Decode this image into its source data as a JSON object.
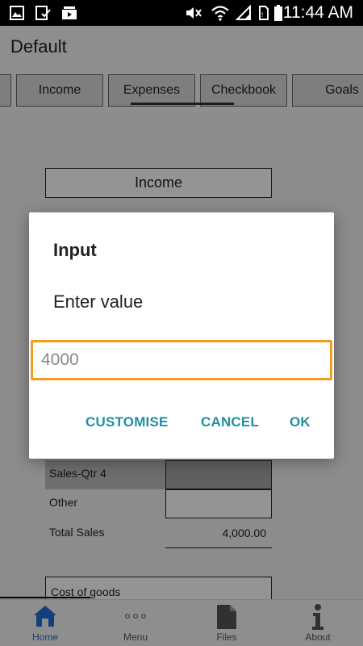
{
  "status_bar": {
    "time": "11:44 AM",
    "icons": [
      "gallery-icon",
      "download-done-icon",
      "video-icon",
      "mute-icon",
      "wifi-icon",
      "signal-icon",
      "sim-icon",
      "battery-icon"
    ]
  },
  "app": {
    "title": "Default"
  },
  "tabs": [
    {
      "label": ""
    },
    {
      "label": "Income"
    },
    {
      "label": "Expenses"
    },
    {
      "label": "Checkbook"
    },
    {
      "label": "Goals"
    }
  ],
  "content": {
    "section_title": "Income",
    "rows": [
      {
        "label": "Sales-Qtr 4",
        "value": ""
      },
      {
        "label": "Other",
        "value": ""
      },
      {
        "label": "Total Sales",
        "value": "4,000.00"
      }
    ],
    "cost_of_goods_label": "Cost of goods"
  },
  "dialog": {
    "title": "Input",
    "message": "Enter value",
    "input_value": "4000",
    "buttons": {
      "customise": "CUSTOMISE",
      "cancel": "CANCEL",
      "ok": "OK"
    }
  },
  "bottom_nav": [
    {
      "label": "Home",
      "icon": "home-icon",
      "active": true
    },
    {
      "label": "Menu",
      "icon": "more-dots-icon",
      "active": false
    },
    {
      "label": "Files",
      "icon": "file-icon",
      "active": false
    },
    {
      "label": "About",
      "icon": "info-icon",
      "active": false
    }
  ],
  "colors": {
    "accent": "#1f8fa3",
    "input_focus": "#f29b1f",
    "home_active": "#1e6fd6"
  }
}
